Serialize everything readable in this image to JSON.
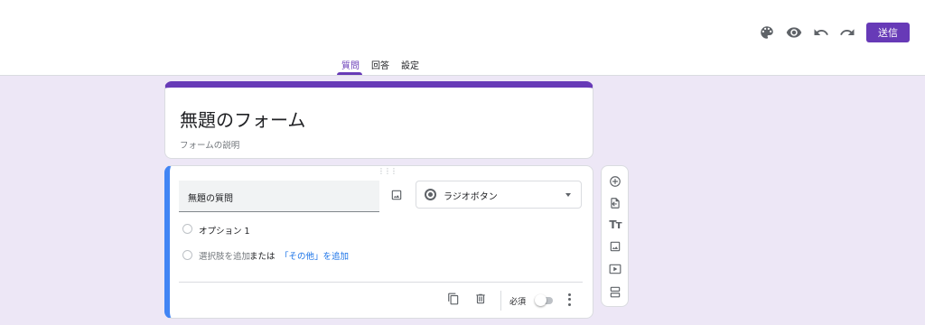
{
  "header": {
    "send_label": "送信",
    "icons": [
      "palette-icon",
      "preview-eye-icon",
      "undo-icon",
      "redo-icon"
    ],
    "accent_color": "#673ab7"
  },
  "tabs": [
    {
      "label": "質問",
      "active": true
    },
    {
      "label": "回答",
      "active": false
    },
    {
      "label": "設定",
      "active": false
    }
  ],
  "form": {
    "title": "無題のフォーム",
    "description_placeholder": "フォームの説明"
  },
  "question": {
    "title": "無題の質問",
    "type": "ラジオボタン",
    "options": [
      "オプション 1"
    ],
    "add_option": "選択肢を追加",
    "or": "または",
    "add_other": "「その他」を追加",
    "required_label": "必須",
    "required": false
  },
  "sidebar_tools": [
    "add-question-icon",
    "import-questions-icon",
    "add-title-icon",
    "add-image-icon",
    "add-video-icon",
    "add-section-icon"
  ]
}
